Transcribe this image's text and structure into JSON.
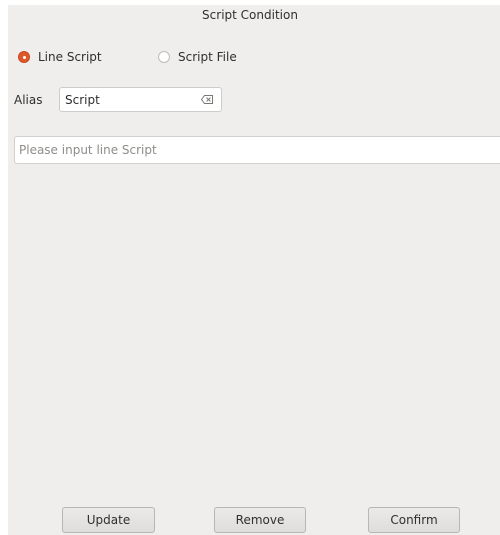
{
  "window": {
    "title": "Script Condition"
  },
  "mode": {
    "options": [
      {
        "label": "Line Script",
        "selected": true
      },
      {
        "label": "Script File",
        "selected": false
      }
    ]
  },
  "alias": {
    "label": "Alias",
    "value": "Script",
    "clear_icon": "clear-text-icon"
  },
  "script_input": {
    "placeholder": "Please input line Script",
    "value": ""
  },
  "buttons": {
    "update_label": "Update",
    "remove_label": "Remove",
    "confirm_label": "Confirm"
  },
  "colors": {
    "accent": "#e0582a",
    "background": "#efeeec"
  }
}
